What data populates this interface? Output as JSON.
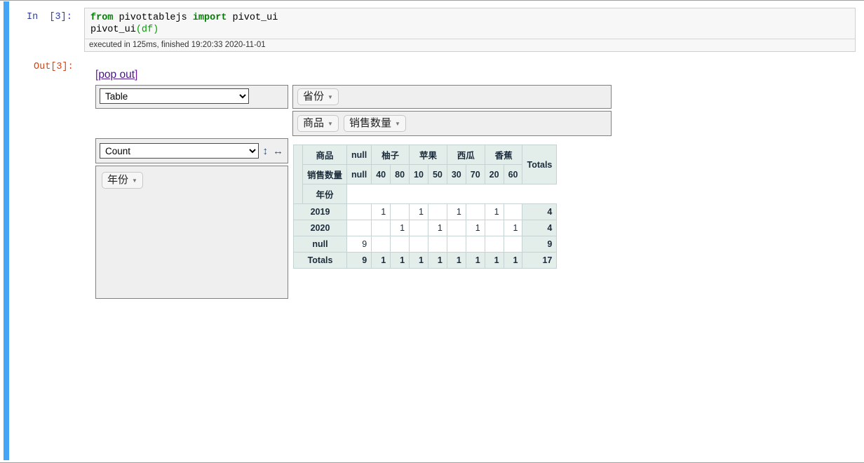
{
  "notebook": {
    "in_prompt": "In  [3]:",
    "out_prompt": "Out[3]:",
    "code_line1_kw1": "from",
    "code_line1_mid": " pivottablejs ",
    "code_line1_kw2": "import",
    "code_line1_end": " pivot_ui",
    "code_line2_name": "pivot_ui",
    "code_line2_args": "(df)",
    "exec_info": "executed in 125ms, finished 19:20:33 2020-11-01"
  },
  "output": {
    "popout_open": "[",
    "popout_label": "pop out",
    "popout_close": "]"
  },
  "pivot_controls": {
    "renderer_selected": "Table",
    "renderer_options": [
      "Table"
    ],
    "aggregator_selected": "Count",
    "aggregator_options": [
      "Count"
    ],
    "sort_vertical_icon": "updown-arrow-icon",
    "sort_vertical_glyph": "↕",
    "sort_horizontal_icon": "leftright-arrow-icon",
    "sort_horizontal_glyph": "↔",
    "caret_glyph": "▼",
    "unused_attributes": [
      {
        "label": "年份"
      }
    ],
    "column_attributes": [
      {
        "label": "省份"
      }
    ],
    "row_attributes": [
      {
        "label": "商品"
      },
      {
        "label": "销售数量"
      }
    ]
  },
  "chart_data": {
    "type": "table",
    "title": "",
    "aggregator": "Count",
    "renderer": "Table",
    "row_field": "年份",
    "col_fields": [
      "商品",
      "销售数量"
    ],
    "col_header_level1": [
      {
        "label": "null",
        "span": 1
      },
      {
        "label": "柚子",
        "span": 2
      },
      {
        "label": "苹果",
        "span": 2
      },
      {
        "label": "西瓜",
        "span": 2
      },
      {
        "label": "香蕉",
        "span": 2
      }
    ],
    "col_header_level2": [
      "null",
      "40",
      "80",
      "10",
      "50",
      "30",
      "70",
      "20",
      "60"
    ],
    "totals_header": "Totals",
    "row_axis_label": "年份",
    "rows": [
      {
        "label": "2019",
        "values": [
          "",
          "1",
          "",
          "1",
          "",
          "1",
          "",
          "1",
          ""
        ],
        "total": "4"
      },
      {
        "label": "2020",
        "values": [
          "",
          "",
          "1",
          "",
          "1",
          "",
          "1",
          "",
          "1"
        ],
        "total": "4"
      },
      {
        "label": "null",
        "values": [
          "9",
          "",
          "",
          "",
          "",
          "",
          "",
          "",
          ""
        ],
        "total": "9"
      }
    ],
    "totals_row": {
      "label": "Totals",
      "values": [
        "9",
        "1",
        "1",
        "1",
        "1",
        "1",
        "1",
        "1",
        "1"
      ],
      "total": "17"
    }
  },
  "colors": {
    "selection_bar": "#42a5f5",
    "header_bg": "#e3eeeb",
    "cell_border": "#c6d3d3",
    "box_bg": "#efefef",
    "in_prompt": "#303f9f",
    "out_prompt": "#d84315",
    "keyword": "#008000",
    "link": "#4a148c"
  }
}
